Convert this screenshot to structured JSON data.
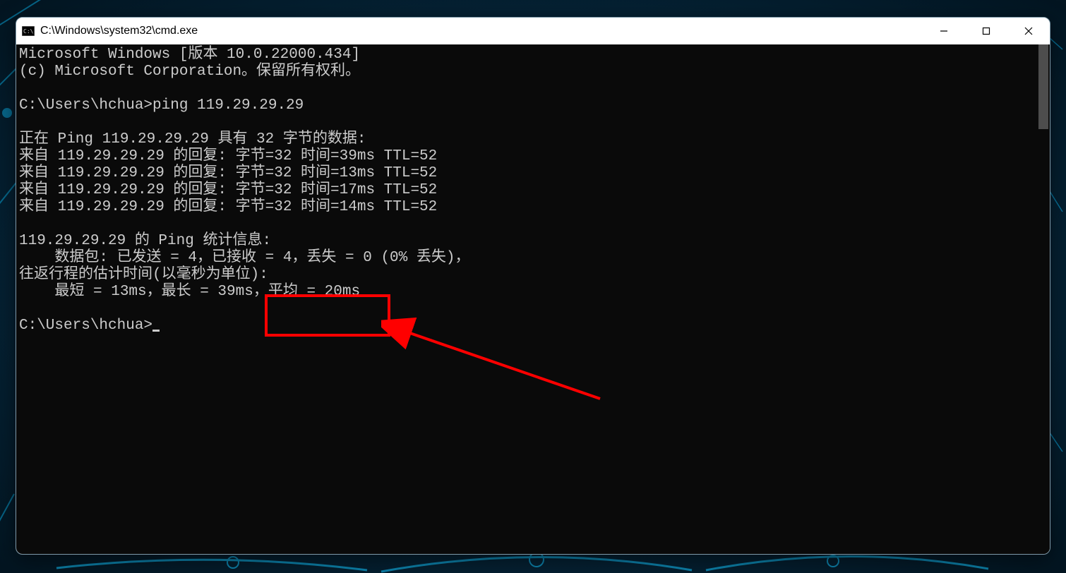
{
  "window": {
    "title": "C:\\Windows\\system32\\cmd.exe"
  },
  "terminal": {
    "version_line": "Microsoft Windows [版本 10.0.22000.434]",
    "copyright_line": "(c) Microsoft Corporation。保留所有权利。",
    "blank": "",
    "prompt1": "C:\\Users\\hchua>ping 119.29.29.29",
    "ping_header": "正在 Ping 119.29.29.29 具有 32 字节的数据:",
    "reply1": "来自 119.29.29.29 的回复: 字节=32 时间=39ms TTL=52",
    "reply2": "来自 119.29.29.29 的回复: 字节=32 时间=13ms TTL=52",
    "reply3": "来自 119.29.29.29 的回复: 字节=32 时间=17ms TTL=52",
    "reply4": "来自 119.29.29.29 的回复: 字节=32 时间=14ms TTL=52",
    "stats_header": "119.29.29.29 的 Ping 统计信息:",
    "packets_line": "    数据包: 已发送 = 4，已接收 = 4，丢失 = 0 (0% 丢失)，",
    "rtt_header": "往返行程的估计时间(以毫秒为单位):",
    "rtt_values": "    最短 = 13ms，最长 = 39ms，平均 = 20ms",
    "prompt2": "C:\\Users\\hchua>"
  },
  "annotation": {
    "box_highlight": "平均 = 20ms"
  }
}
